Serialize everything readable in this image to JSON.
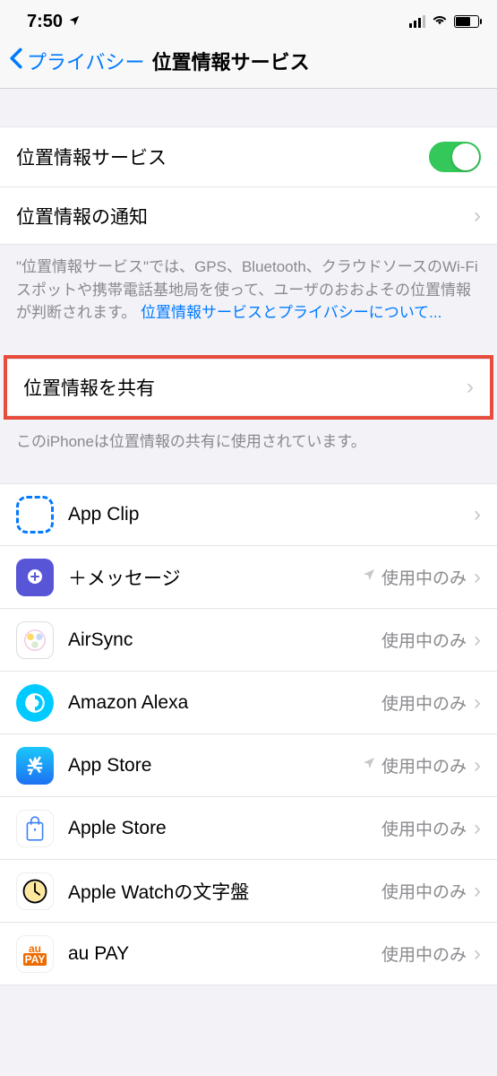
{
  "status": {
    "time": "7:50"
  },
  "nav": {
    "back": "プライバシー",
    "title": "位置情報サービス"
  },
  "rows": {
    "location_services": "位置情報サービス",
    "location_alerts": "位置情報の通知",
    "share_location": "位置情報を共有"
  },
  "footer1_a": "\"位置情報サービス\"では、GPS、Bluetooth、クラウドソースのWi-Fiスポットや携帯電話基地局を使って、ユーザのおおよその位置情報が判断されます。 ",
  "footer1_link": "位置情報サービスとプライバシーについて...",
  "footer2": "このiPhoneは位置情報の共有に使用されています。",
  "status_label": "使用中のみ",
  "apps": [
    {
      "name": "App Clip",
      "icon": "appclip",
      "status": "",
      "arrow": false
    },
    {
      "name": "＋メッセージ",
      "icon": "plusmsg",
      "status": "使用中のみ",
      "arrow": true
    },
    {
      "name": "AirSync",
      "icon": "airsync",
      "status": "使用中のみ",
      "arrow": false
    },
    {
      "name": "Amazon Alexa",
      "icon": "alexa",
      "status": "使用中のみ",
      "arrow": false
    },
    {
      "name": "App Store",
      "icon": "appstore",
      "status": "使用中のみ",
      "arrow": true
    },
    {
      "name": "Apple Store",
      "icon": "applestore",
      "status": "使用中のみ",
      "arrow": false
    },
    {
      "name": "Apple Watchの文字盤",
      "icon": "watch",
      "status": "使用中のみ",
      "arrow": false
    },
    {
      "name": "au PAY",
      "icon": "aupay",
      "status": "使用中のみ",
      "arrow": false
    }
  ]
}
